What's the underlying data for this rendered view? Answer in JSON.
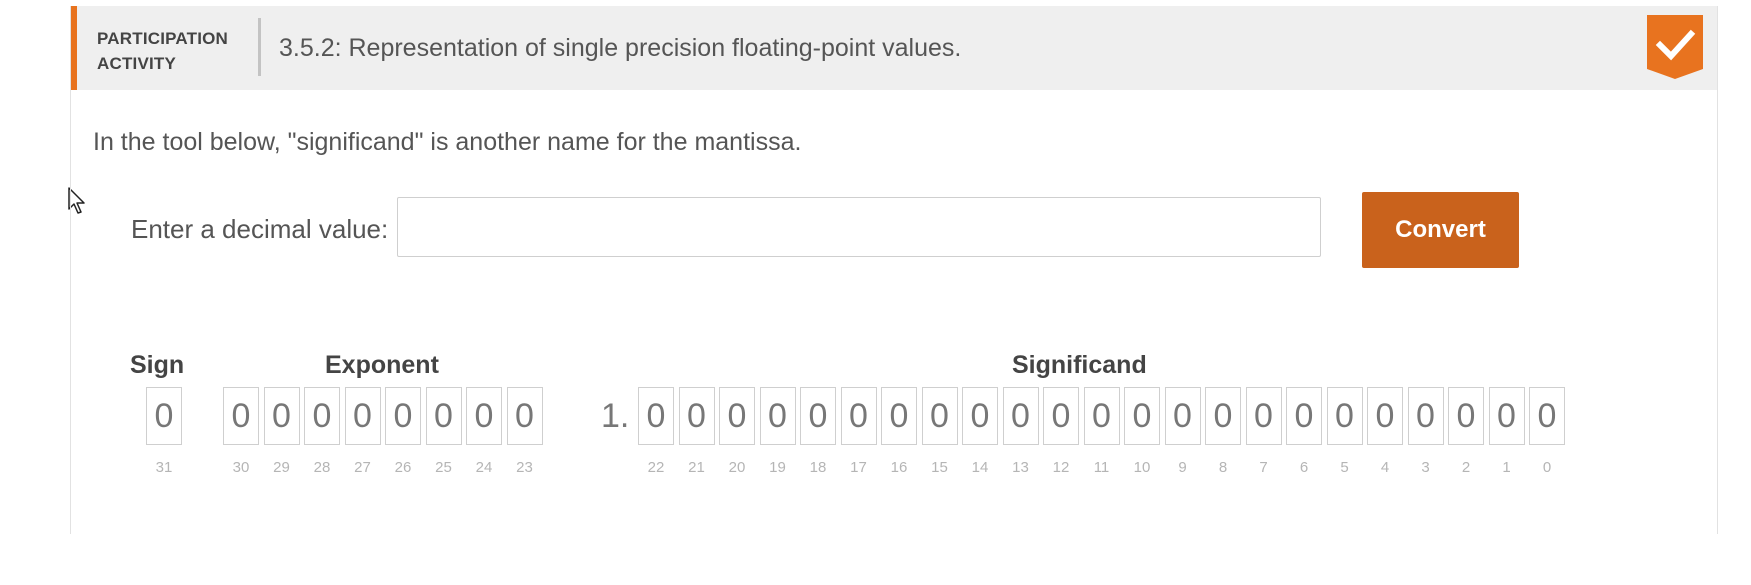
{
  "header": {
    "label": "PARTICIPATION ACTIVITY",
    "title": "3.5.2: Representation of single precision floating-point values.",
    "completed": true,
    "accent_color": "#e8731f",
    "badge_icon": "checkmark-icon"
  },
  "intro_text": "In the tool below, \"significand\" is another name for the mantissa.",
  "converter": {
    "input_label": "Enter a decimal value:",
    "input_value": "",
    "input_placeholder": "",
    "button_label": "Convert",
    "button_color": "#c9621c"
  },
  "fields": {
    "sign_label": "Sign",
    "exponent_label": "Exponent",
    "significand_label": "Significand",
    "implicit_prefix": "1.",
    "sign_bits": [
      {
        "value": "0",
        "index": "31"
      }
    ],
    "exponent_bits": [
      {
        "value": "0",
        "index": "30"
      },
      {
        "value": "0",
        "index": "29"
      },
      {
        "value": "0",
        "index": "28"
      },
      {
        "value": "0",
        "index": "27"
      },
      {
        "value": "0",
        "index": "26"
      },
      {
        "value": "0",
        "index": "25"
      },
      {
        "value": "0",
        "index": "24"
      },
      {
        "value": "0",
        "index": "23"
      }
    ],
    "significand_bits": [
      {
        "value": "0",
        "index": "22"
      },
      {
        "value": "0",
        "index": "21"
      },
      {
        "value": "0",
        "index": "20"
      },
      {
        "value": "0",
        "index": "19"
      },
      {
        "value": "0",
        "index": "18"
      },
      {
        "value": "0",
        "index": "17"
      },
      {
        "value": "0",
        "index": "16"
      },
      {
        "value": "0",
        "index": "15"
      },
      {
        "value": "0",
        "index": "14"
      },
      {
        "value": "0",
        "index": "13"
      },
      {
        "value": "0",
        "index": "12"
      },
      {
        "value": "0",
        "index": "11"
      },
      {
        "value": "0",
        "index": "10"
      },
      {
        "value": "0",
        "index": "9"
      },
      {
        "value": "0",
        "index": "8"
      },
      {
        "value": "0",
        "index": "7"
      },
      {
        "value": "0",
        "index": "6"
      },
      {
        "value": "0",
        "index": "5"
      },
      {
        "value": "0",
        "index": "4"
      },
      {
        "value": "0",
        "index": "3"
      },
      {
        "value": "0",
        "index": "2"
      },
      {
        "value": "0",
        "index": "1"
      },
      {
        "value": "0",
        "index": "0"
      }
    ]
  }
}
